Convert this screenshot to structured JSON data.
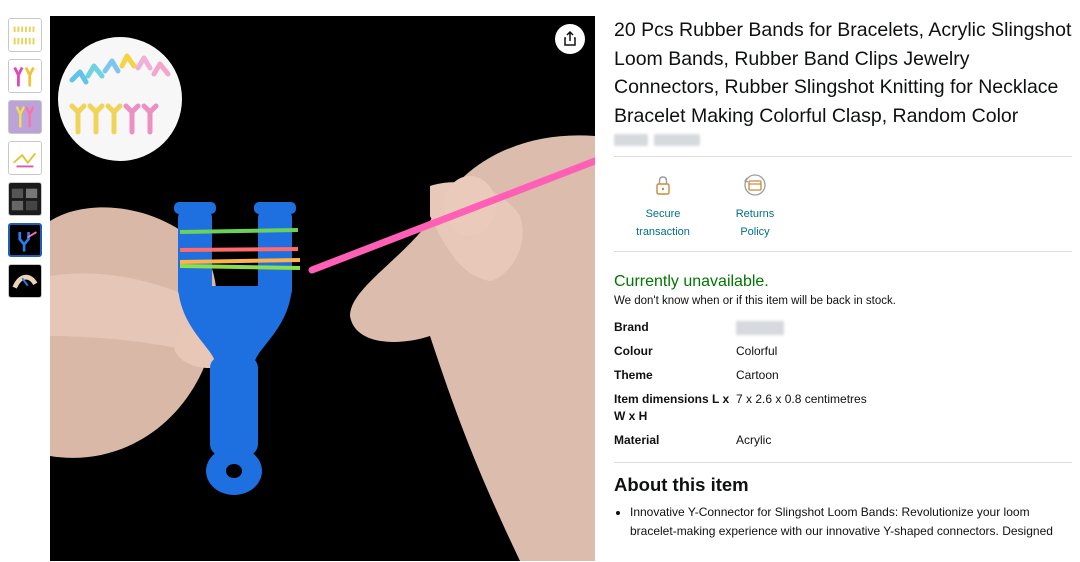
{
  "product": {
    "title": "20 Pcs Rubber Bands for Bracelets, Acrylic Slingshot Loom Bands, Rubber Band Clips Jewelry Connectors, Rubber Slingshot Knitting for Necklace Bracelet Making Colorful Clasp, Random Color"
  },
  "features": [
    {
      "label": "Secure transaction",
      "icon": "lock-icon"
    },
    {
      "label": "Returns Policy",
      "icon": "returns-icon"
    }
  ],
  "availability": {
    "status": "Currently unavailable.",
    "note": "We don't know when or if this item will be back in stock."
  },
  "specs": [
    {
      "key": "Brand",
      "value": ""
    },
    {
      "key": "Colour",
      "value": "Colorful"
    },
    {
      "key": "Theme",
      "value": "Cartoon"
    },
    {
      "key": "Item dimensions L x W x H",
      "value": "7 x 2.6 x 0.8 centimetres"
    },
    {
      "key": "Material",
      "value": "Acrylic"
    }
  ],
  "about": {
    "heading": "About this item",
    "bullets": [
      "Innovative Y-Connector for Slingshot Loom Bands: Revolutionize your loom bracelet-making experience with our innovative Y-shaped connectors. Designed"
    ]
  },
  "colors": {
    "accent_link": "#007185",
    "available_green": "#007600",
    "thumb_active_border": "#1e5fb4",
    "connector_blue": "#1e6fe0"
  },
  "icons": {
    "share": "share-icon"
  }
}
